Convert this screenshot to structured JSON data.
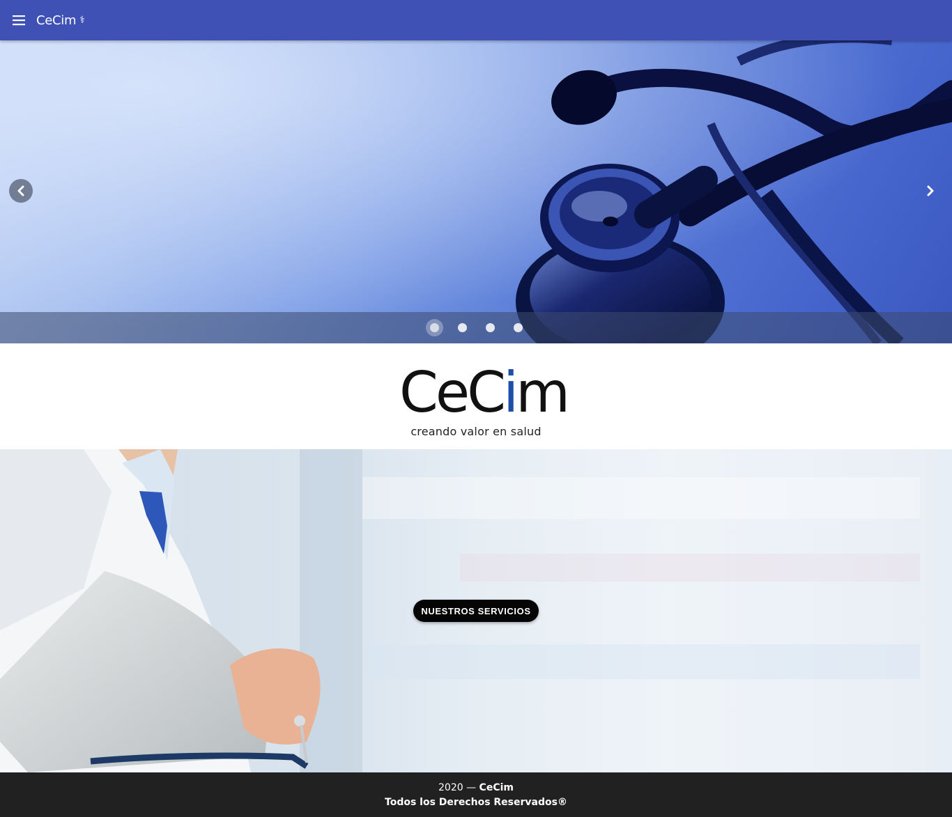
{
  "app_bar": {
    "title": "CeCim",
    "title_glyph": "⚕",
    "menu_icon": "menu-icon",
    "color": "#3f51b5"
  },
  "carousel": {
    "prev_icon": "chevron-left-icon",
    "next_icon": "chevron-right-icon",
    "slide_count": 4,
    "active_slide": 1
  },
  "logo": {
    "word_part1": "CeC",
    "word_part2": "i",
    "word_part3": "m",
    "tagline": "creando valor en salud",
    "accent_color": "#1e4fa8"
  },
  "hero": {
    "button_label": "NUESTROS SERVICIOS"
  },
  "footer": {
    "year_text": "2020 — ",
    "brand": "CeCim",
    "rights": "Todos los Derechos Reservados®"
  }
}
